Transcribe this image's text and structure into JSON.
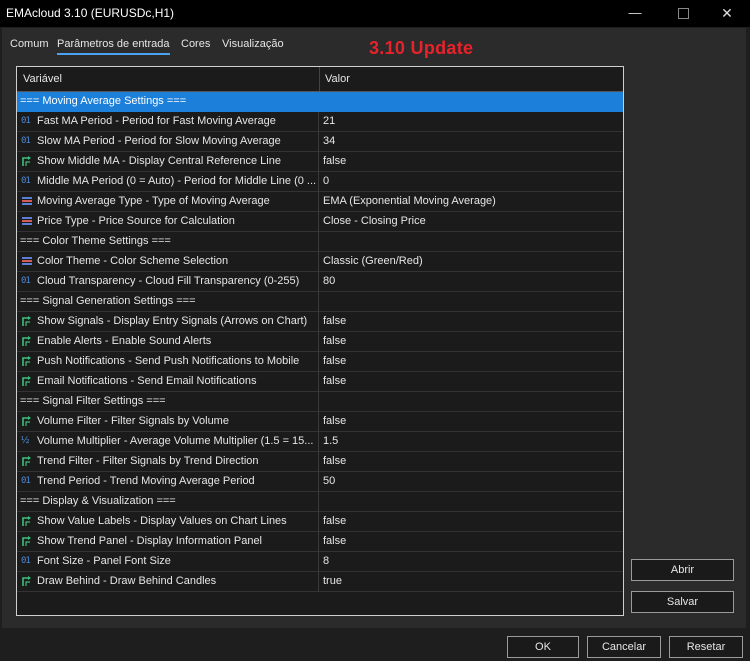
{
  "window": {
    "title": "EMAcloud 3.10 (EURUSDc,H1)"
  },
  "tabs": [
    {
      "label": "Comum"
    },
    {
      "label": "Parâmetros de entrada"
    },
    {
      "label": "Cores"
    },
    {
      "label": "Visualização"
    }
  ],
  "banner": "3.10  Update",
  "table": {
    "col_name": "Variável",
    "col_value": "Valor",
    "rows": [
      {
        "kind": "header",
        "name": "=== Moving Average Settings ===",
        "value": "",
        "selected": true
      },
      {
        "kind": "param",
        "icon": "int-icon",
        "name": "Fast MA Period - Period for Fast Moving Average",
        "value": "21"
      },
      {
        "kind": "param",
        "icon": "int-icon",
        "name": "Slow MA Period - Period for Slow Moving Average",
        "value": "34"
      },
      {
        "kind": "param",
        "icon": "bool-icon",
        "name": "Show Middle MA - Display Central Reference Line",
        "value": "false"
      },
      {
        "kind": "param",
        "icon": "int-icon",
        "name": "Middle MA Period (0 = Auto) - Period for Middle Line (0 ...",
        "value": "0"
      },
      {
        "kind": "param",
        "icon": "enum-icon",
        "name": "Moving Average Type - Type of Moving Average",
        "value": "EMA (Exponential Moving Average)"
      },
      {
        "kind": "param",
        "icon": "enum-icon",
        "name": "Price Type - Price Source for Calculation",
        "value": "Close - Closing Price"
      },
      {
        "kind": "header",
        "name": "=== Color Theme Settings ===",
        "value": ""
      },
      {
        "kind": "param",
        "icon": "enum-icon",
        "name": "Color Theme - Color Scheme Selection",
        "value": "Classic (Green/Red)"
      },
      {
        "kind": "param",
        "icon": "int-icon",
        "name": "Cloud Transparency - Cloud Fill Transparency (0-255)",
        "value": "80"
      },
      {
        "kind": "header",
        "name": "=== Signal Generation Settings ===",
        "value": ""
      },
      {
        "kind": "param",
        "icon": "bool-icon",
        "name": "Show Signals - Display Entry Signals (Arrows on Chart)",
        "value": "false"
      },
      {
        "kind": "param",
        "icon": "bool-icon",
        "name": "Enable Alerts - Enable Sound Alerts",
        "value": "false"
      },
      {
        "kind": "param",
        "icon": "bool-icon",
        "name": "Push Notifications - Send Push Notifications to Mobile",
        "value": "false"
      },
      {
        "kind": "param",
        "icon": "bool-icon",
        "name": "Email Notifications - Send Email Notifications",
        "value": "false"
      },
      {
        "kind": "header",
        "name": "=== Signal Filter Settings ===",
        "value": ""
      },
      {
        "kind": "param",
        "icon": "bool-icon",
        "name": "Volume Filter - Filter Signals by Volume",
        "value": "false"
      },
      {
        "kind": "param",
        "icon": "double-icon",
        "name": "Volume Multiplier - Average Volume Multiplier (1.5 = 15...",
        "value": "1.5"
      },
      {
        "kind": "param",
        "icon": "bool-icon",
        "name": "Trend Filter - Filter Signals by Trend Direction",
        "value": "false"
      },
      {
        "kind": "param",
        "icon": "int-icon",
        "name": "Trend Period - Trend Moving Average Period",
        "value": "50"
      },
      {
        "kind": "header",
        "name": "=== Display & Visualization ===",
        "value": ""
      },
      {
        "kind": "param",
        "icon": "bool-icon",
        "name": "Show Value Labels - Display Values on Chart Lines",
        "value": "false"
      },
      {
        "kind": "param",
        "icon": "bool-icon",
        "name": "Show Trend Panel - Display Information Panel",
        "value": "false"
      },
      {
        "kind": "param",
        "icon": "int-icon",
        "name": "Font Size - Panel Font Size",
        "value": "8"
      },
      {
        "kind": "param",
        "icon": "bool-icon",
        "name": "Draw Behind - Draw Behind Candles",
        "value": "true"
      }
    ]
  },
  "buttons": {
    "open": "Abrir",
    "save": "Salvar",
    "ok": "OK",
    "cancel": "Cancelar",
    "reset": "Resetar"
  },
  "colors": {
    "accent": "#1c7fd9",
    "banner": "#e8222b"
  }
}
